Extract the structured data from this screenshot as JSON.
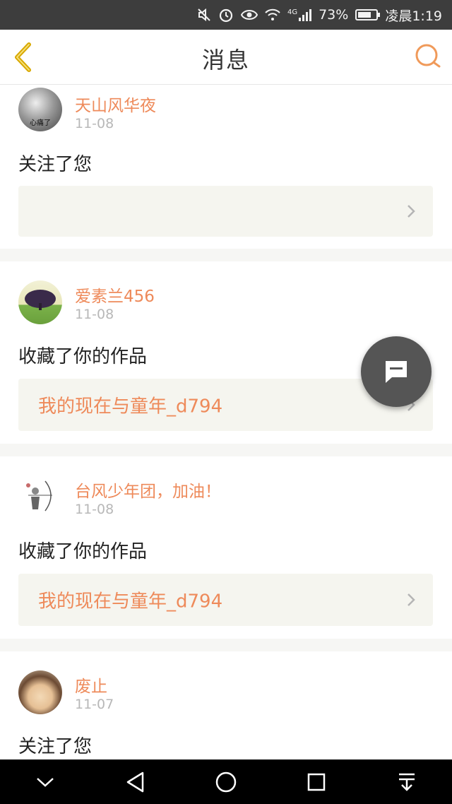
{
  "status_bar": {
    "battery": "73%",
    "time": "凌晨1:19",
    "network": "4G",
    "icons": [
      "mute-icon",
      "alarm-icon",
      "eye-icon",
      "wifi-icon",
      "signal-icon",
      "battery-icon"
    ]
  },
  "header": {
    "title": "消息",
    "back_icon": "chevron-left-icon",
    "search_icon": "search-icon"
  },
  "notifications": [
    {
      "user": "天山风华夜",
      "date": "11-08",
      "action": "关注了您",
      "link": ""
    },
    {
      "user": "爱素兰456",
      "date": "11-08",
      "action": "收藏了你的作品",
      "link": "我的现在与童年_d794"
    },
    {
      "user": "台风少年团，加油！",
      "date": "11-08",
      "action": "收藏了你的作品",
      "link": "我的现在与童年_d794"
    },
    {
      "user": "废止",
      "date": "11-07",
      "action": "关注了您",
      "link": ""
    }
  ],
  "avatar_badge": "心痛了",
  "colors": {
    "accent": "#ee8a5a",
    "header_bg": "#ffffff",
    "statusbar_bg": "#3d3d3d",
    "fab_bg": "#555555"
  },
  "fab_icon": "chat-bubble-icon",
  "nav_bar": [
    "chevron-down-icon",
    "back-triangle-icon",
    "home-circle-icon",
    "recents-square-icon",
    "pull-down-icon"
  ]
}
